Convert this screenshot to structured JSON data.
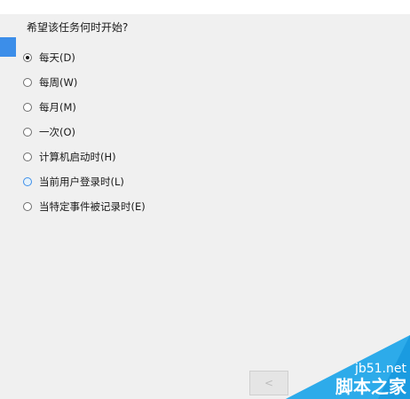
{
  "question": "希望该任务何时开始?",
  "options": [
    {
      "label": "每天(D)",
      "checked": true
    },
    {
      "label": "每周(W)",
      "checked": false
    },
    {
      "label": "每月(M)",
      "checked": false
    },
    {
      "label": "一次(O)",
      "checked": false
    },
    {
      "label": "计算机启动时(H)",
      "checked": false
    },
    {
      "label": "当前用户登录时(L)",
      "checked": false,
      "hovered": true
    },
    {
      "label": "当特定事件被记录时(E)",
      "checked": false
    }
  ],
  "navigation": {
    "back_label": "<"
  },
  "watermark": {
    "site": "jb51.net",
    "name": "脚本之家"
  },
  "colors": {
    "accent": "#3c8ee9",
    "background": "#f0f0f0"
  }
}
